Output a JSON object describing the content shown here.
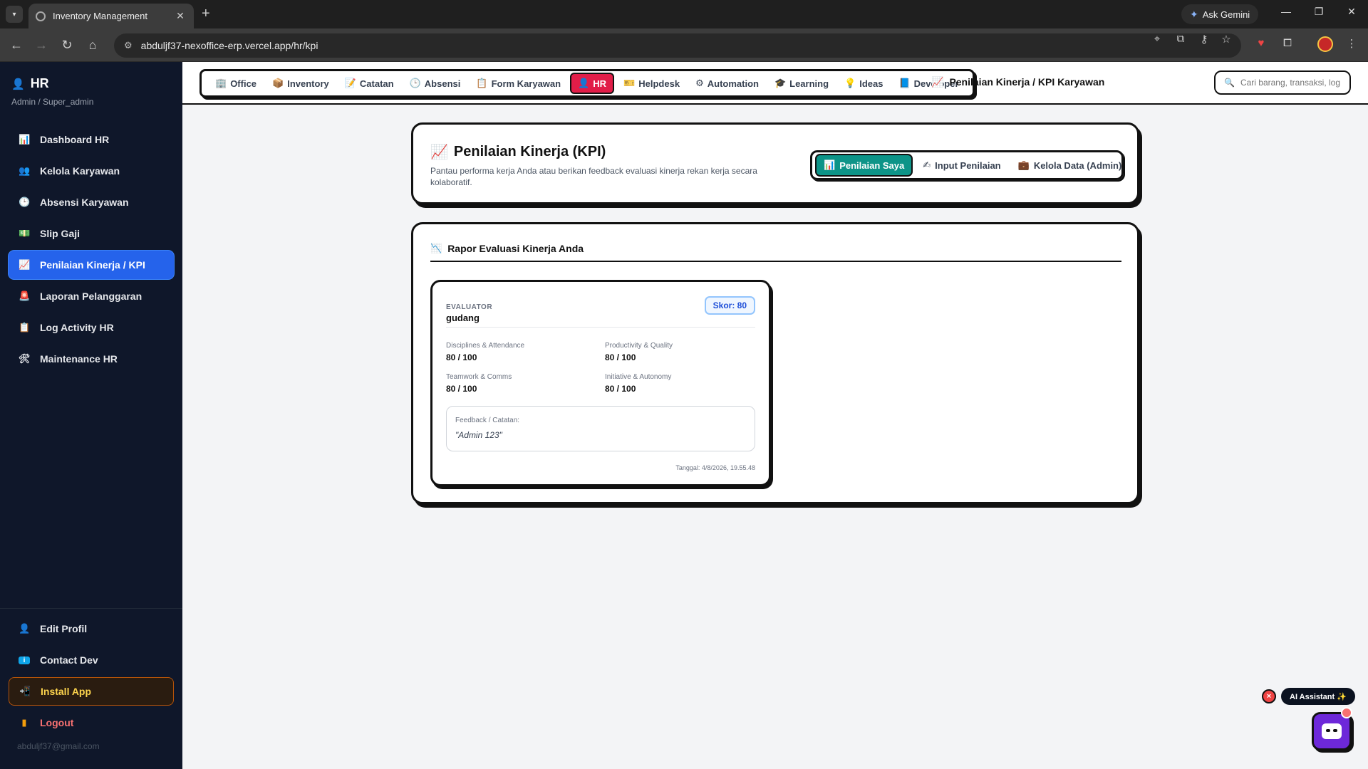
{
  "browser": {
    "tab_title": "Inventory Management",
    "url": "abduljf37-nexoffice-erp.vercel.app/hr/kpi",
    "gemini_label": "Ask Gemini"
  },
  "sidebar": {
    "title": "HR",
    "subtitle": "Admin / Super_admin",
    "items": [
      {
        "label": "Dashboard HR",
        "icon": "📊"
      },
      {
        "label": "Kelola Karyawan",
        "icon": "👥"
      },
      {
        "label": "Absensi Karyawan",
        "icon": "🕒"
      },
      {
        "label": "Slip Gaji",
        "icon": "💵"
      },
      {
        "label": "Penilaian Kinerja / KPI",
        "icon": "📈"
      },
      {
        "label": "Laporan Pelanggaran",
        "icon": "🚨"
      },
      {
        "label": "Log Activity HR",
        "icon": "📋"
      },
      {
        "label": "Maintenance HR",
        "icon": "🛠"
      }
    ],
    "bottom": {
      "edit_profile": "Edit Profil",
      "contact_dev": "Contact Dev",
      "install_app": "Install App",
      "logout": "Logout",
      "email": "abduljf37@gmail.com"
    }
  },
  "topnav": {
    "items": [
      "Office",
      "Inventory",
      "Catatan",
      "Absensi",
      "Form Karyawan",
      "HR",
      "Helpdesk",
      "Automation",
      "Learning",
      "Ideas",
      "Developer"
    ],
    "icons": [
      "🏢",
      "📦",
      "📝",
      "🕒",
      "📋",
      "👤",
      "🎫",
      "⚙",
      "🎓",
      "💡",
      "📘"
    ],
    "active": "HR",
    "breadcrumb": "Penilaian Kinerja / KPI Karyawan",
    "search_placeholder": "Cari barang, transaksi, log..."
  },
  "header": {
    "title": "Penilaian Kinerja (KPI)",
    "description": "Pantau performa kerja Anda atau berikan feedback evaluasi kinerja rekan kerja secara kolaboratif.",
    "tabs": [
      {
        "label": "Penilaian Saya",
        "icon": "📊"
      },
      {
        "label": "Input Penilaian",
        "icon": "✍"
      },
      {
        "label": "Kelola Data (Admin)",
        "icon": "💼"
      }
    ]
  },
  "rapor": {
    "title": "Rapor Evaluasi Kinerja Anda",
    "evaluator_label": "EVALUATOR",
    "evaluator_name": "gudang",
    "score": "Skor: 80",
    "metrics": [
      {
        "label": "Disciplines & Attendance",
        "value": "80 / 100"
      },
      {
        "label": "Productivity & Quality",
        "value": "80 / 100"
      },
      {
        "label": "Teamwork & Comms",
        "value": "80 / 100"
      },
      {
        "label": "Initiative & Autonomy",
        "value": "80 / 100"
      }
    ],
    "feedback_label": "Feedback / Catatan:",
    "feedback_text": "\"Admin 123\"",
    "date": "Tanggal: 4/8/2026, 19.55.48"
  },
  "assistant": {
    "label": "AI Assistant ✨",
    "close": "×"
  },
  "colors": {
    "sidebar_bg": "#0f172a",
    "sidebar_active": "#2563eb",
    "nav_active": "#e11d48",
    "tab_active": "#0d9488",
    "score_blue": "#1d4ed8"
  }
}
